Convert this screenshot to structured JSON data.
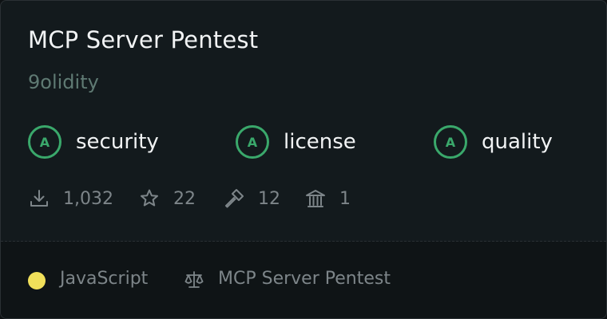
{
  "card": {
    "title": "MCP Server Pentest",
    "author": "9olidity"
  },
  "badges": [
    {
      "grade": "A",
      "label": "security"
    },
    {
      "grade": "A",
      "label": "license"
    },
    {
      "grade": "A",
      "label": "quality"
    }
  ],
  "stats": {
    "downloads": "1,032",
    "stars": "22",
    "tools": "12",
    "institutions": "1"
  },
  "footer": {
    "language": "JavaScript",
    "language_color": "#f1e05a",
    "license": "MCP Server Pentest"
  },
  "icons": {
    "downloads": "download-icon",
    "stars": "star-icon",
    "tools": "hammer-icon",
    "institutions": "bank-icon",
    "license": "scale-icon"
  },
  "colors": {
    "grade": "#3aa86b",
    "background": "#131a1d"
  }
}
